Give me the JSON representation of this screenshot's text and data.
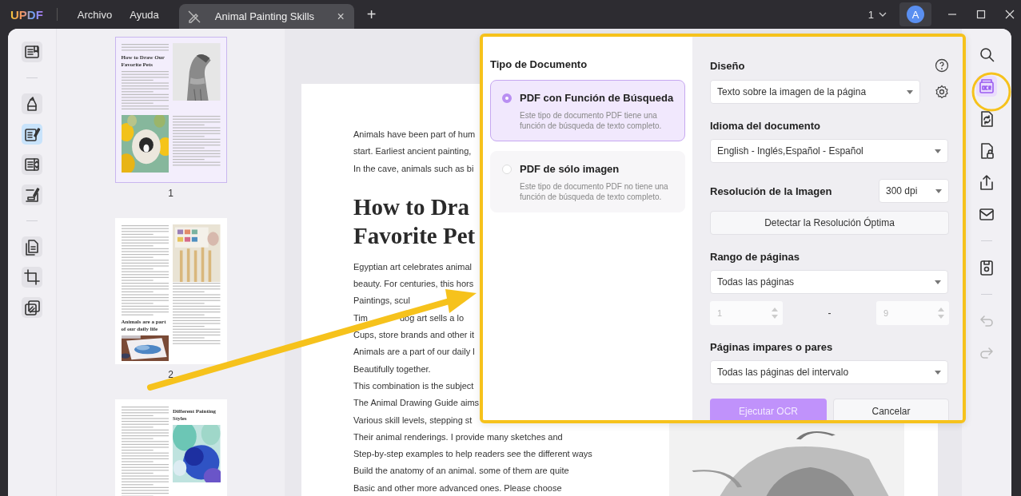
{
  "app": {
    "logo": "UPDF",
    "menu": [
      "Archivo",
      "Ayuda"
    ]
  },
  "tabs": [
    {
      "title": "Animal Painting Skills",
      "selected": true,
      "close": "×"
    }
  ],
  "new_tab": "+",
  "page_indicator": "1",
  "avatar": "A",
  "left_tools": [
    {
      "kind": "reader",
      "selected": false
    },
    {
      "kind": "divider"
    },
    {
      "kind": "marker",
      "selected": false
    },
    {
      "kind": "edit",
      "selected": true
    },
    {
      "kind": "form",
      "selected": false
    },
    {
      "kind": "sign",
      "selected": false
    },
    {
      "kind": "divider"
    },
    {
      "kind": "pages",
      "selected": false
    },
    {
      "kind": "crop",
      "selected": false
    },
    {
      "kind": "layers",
      "selected": false
    }
  ],
  "thumbnails": [
    {
      "kind": "a",
      "number": "1",
      "selected": true,
      "heading": "How to Draw Our Favorite Pets"
    },
    {
      "kind": "b",
      "number": "2",
      "selected": false,
      "heading": "Animals are a part of our daily life"
    },
    {
      "kind": "c",
      "selected": false,
      "heading": "Different Painting Styles"
    }
  ],
  "document": {
    "intro": [
      "Animals have been part of hum",
      "start. Earliest ancient painting,",
      "In the cave, animals such as bi"
    ],
    "heading": [
      "How to Dra",
      "Favorite Pet"
    ],
    "body": [
      [
        "Egyptian art celebrates animal"
      ],
      [
        "beauty. For centuries, this hors"
      ],
      [
        "Paintings, scul"
      ],
      [
        "Tim",
        "dog art sells a lo"
      ],
      [
        "Cups, store brands and other it"
      ],
      [
        "Animals are a part of our daily l"
      ],
      [
        "Beautifully together."
      ],
      [
        "This combination is the subject"
      ],
      [
        "The Animal Drawing Guide aims"
      ],
      [
        "Various skill levels, stepping st"
      ],
      [
        "Their animal renderings. I provide many sketches and"
      ],
      [
        "Step-by-step examples to help readers see the different ways"
      ],
      [
        "Build the anatomy of an animal. some of them are quite"
      ],
      [
        "Basic and other more advanced ones. Please choose"
      ]
    ]
  },
  "right_tools": [
    {
      "kind": "search",
      "selected": false,
      "disabled": false
    },
    {
      "kind": "ocr",
      "selected": true,
      "disabled": false
    },
    {
      "kind": "convert",
      "selected": false,
      "disabled": false
    },
    {
      "kind": "protect",
      "selected": false,
      "disabled": false
    },
    {
      "kind": "share",
      "selected": false,
      "disabled": false
    },
    {
      "kind": "mail",
      "selected": false,
      "disabled": false
    },
    {
      "kind": "divider"
    },
    {
      "kind": "save",
      "selected": false,
      "disabled": false
    },
    {
      "kind": "divider"
    },
    {
      "kind": "undo",
      "selected": false,
      "disabled": true
    },
    {
      "kind": "redo",
      "selected": false,
      "disabled": true
    }
  ],
  "ocr_dialog": {
    "type_title": "Tipo de Documento",
    "types": [
      {
        "title": "PDF con Función de Búsqueda",
        "description": "Este tipo de documento PDF tiene una función de búsqueda de texto completo.",
        "selected": true
      },
      {
        "title": "PDF de sólo imagen",
        "description": "Este tipo de documento PDF no tiene una función de búsqueda de texto completo.",
        "selected": false
      }
    ],
    "layout_label": "Diseño",
    "layout_value": "Texto sobre la imagen de la página",
    "language_label": "Idioma del documento",
    "language_value": "English - Inglés,Español - Español",
    "resolution_label": "Resolución de la Imagen",
    "resolution_value": "300 dpi",
    "detect_button": "Detectar la Resolución Óptima",
    "range_label": "Rango de páginas",
    "range_value": "Todas las páginas",
    "range_from": {
      "value": "1",
      "disabled": true
    },
    "range_separator": "-",
    "range_to": {
      "value": "9",
      "disabled": true
    },
    "parity_label": "Páginas impares o pares",
    "parity_value": "Todas las páginas del intervalo",
    "run_button": {
      "label": "Ejecutar OCR",
      "disabled": true
    },
    "cancel_button": "Cancelar"
  }
}
